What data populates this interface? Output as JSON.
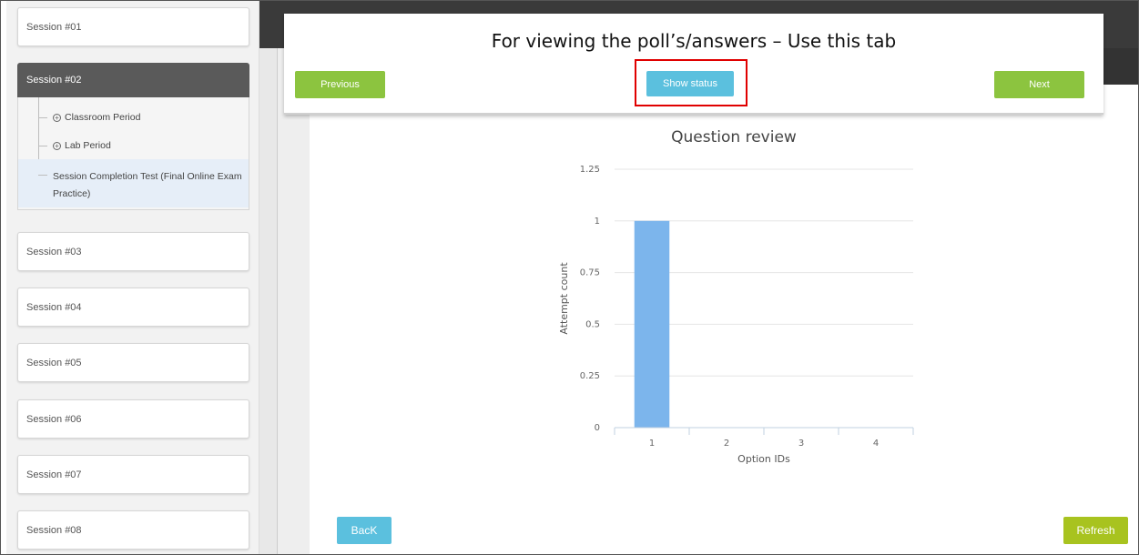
{
  "sidebar": {
    "sessions_top": [
      {
        "label": "Session #01"
      }
    ],
    "active_session": {
      "label": "Session #02",
      "items": [
        {
          "label": "Classroom Period"
        },
        {
          "label": "Lab Period"
        },
        {
          "label": "Session Completion Test (Final Online Exam Practice)"
        }
      ]
    },
    "sessions_bottom": [
      {
        "label": "Session #03"
      },
      {
        "label": "Session #04"
      },
      {
        "label": "Session #05"
      },
      {
        "label": "Session #06"
      },
      {
        "label": "Session #07"
      },
      {
        "label": "Session #08"
      }
    ]
  },
  "panel": {
    "title": "For viewing the poll’s/answers – Use this tab",
    "previous_label": "Previous",
    "show_status_label": "Show status",
    "next_label": "Next"
  },
  "footer": {
    "back_label": "BacK",
    "refresh_label": "Refresh"
  },
  "chart_data": {
    "type": "bar",
    "title": "Question review",
    "xlabel": "Option IDs",
    "ylabel": "Attempt count",
    "categories": [
      "1",
      "2",
      "3",
      "4"
    ],
    "values": [
      1,
      0,
      0,
      0
    ],
    "ylim": [
      0,
      1.25
    ],
    "yticks": [
      "0",
      "0.25",
      "0.5",
      "0.75",
      "1",
      "1.25"
    ],
    "grid": true,
    "bar_color": "#7cb5ec"
  },
  "colors": {
    "accent_green": "#8cc43f",
    "accent_blue": "#5bc0de",
    "refresh_olive": "#a8c31f",
    "highlight_red": "#e00000",
    "active_session_bg": "#5a5a5a"
  }
}
